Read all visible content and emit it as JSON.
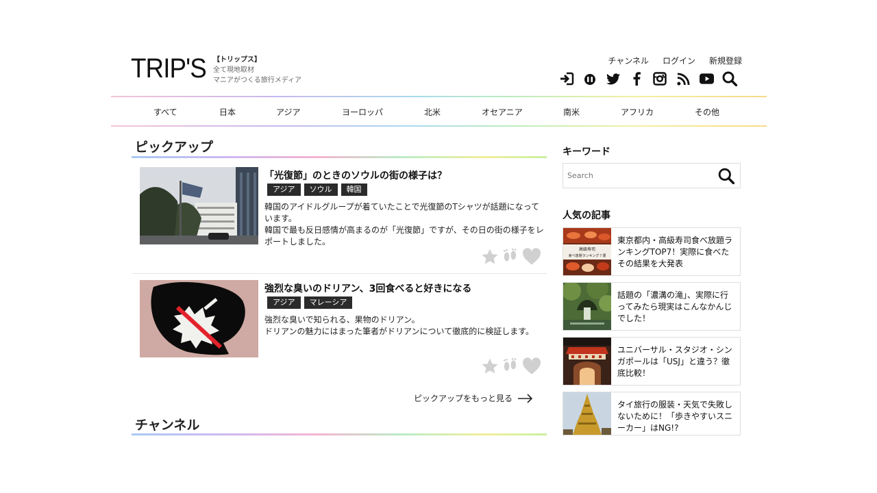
{
  "header": {
    "logo": "TRIP'S",
    "tagline": [
      "【トリップス】",
      "全て現地取材",
      "マニアがつくる旅行メディア"
    ],
    "links": [
      "チャンネル",
      "ログイン",
      "新規登録"
    ],
    "icons": [
      "login-icon",
      "niconico-icon",
      "twitter-icon",
      "facebook-icon",
      "instagram-icon",
      "rss-icon",
      "youtube-icon",
      "search-icon"
    ]
  },
  "nav": [
    "すべて",
    "日本",
    "アジア",
    "ヨーロッパ",
    "北米",
    "オセアニア",
    "南米",
    "アフリカ",
    "その他"
  ],
  "pickup": {
    "title": "ピックアップ",
    "articles": [
      {
        "title": "「光復節」のときのソウルの街の様子は？",
        "tags": [
          "アジア",
          "ソウル",
          "韓国"
        ],
        "desc": [
          "韓国のアイドルグループが着ていたことで光復節のTシャツが話題になっています。",
          "韓国で最も反日感情が高まるのが「光復節」ですが、その日の街の様子をレポートしました。"
        ]
      },
      {
        "title": "強烈な臭いのドリアン、3回食べると好きになる",
        "tags": [
          "アジア",
          "マレーシア"
        ],
        "desc": [
          "強烈な臭いで知られる、果物のドリアン。",
          "ドリアンの魅力にはまった筆者がドリアンについて徹底的に検証します。"
        ]
      }
    ],
    "more": "ピックアップをもっと見る"
  },
  "channel": {
    "title": "チャンネル"
  },
  "sidebar": {
    "keyword_title": "キーワード",
    "search_placeholder": "Search",
    "popular_title": "人気の記事",
    "popular": [
      "東京都内・高級寿司食べ放題ランキングTOP7！実際に食べたその結果を大発表",
      "話題の「濃溝の滝」、実際に行ってみたら現実はこんなかんじでした！",
      "ユニバーサル・スタジオ・シンガポールは「USJ」と違う？徹底比較！",
      "タイ旅行の服装・天気で失敗しないために！「歩きやすいスニーカー」はNG!?"
    ],
    "popular_thumb_text": [
      "高級寿司",
      "食べ放題ランキング７選"
    ]
  }
}
